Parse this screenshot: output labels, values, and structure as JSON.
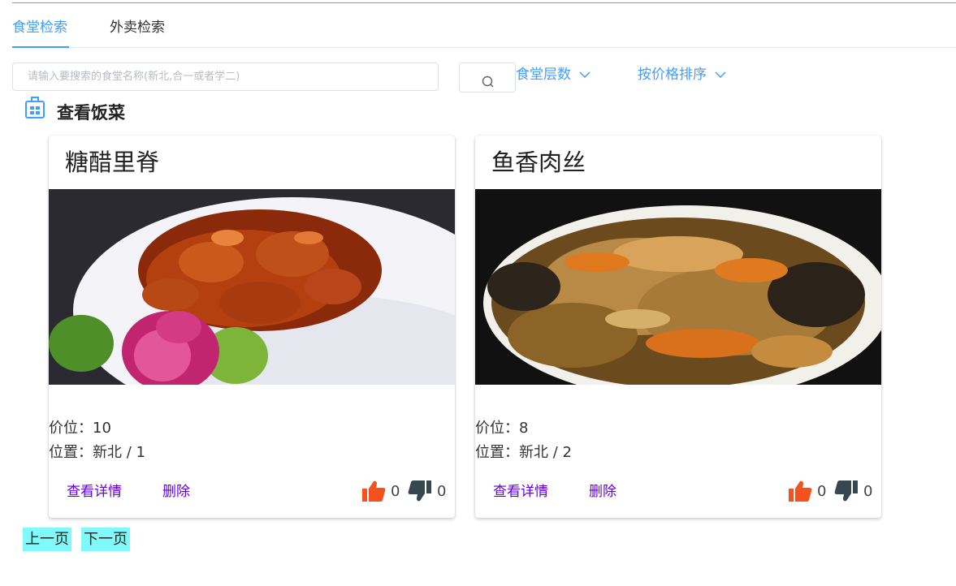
{
  "tabs": [
    {
      "label": "食堂检索",
      "active": true
    },
    {
      "label": "外卖检索",
      "active": false
    }
  ],
  "search": {
    "placeholder": "请输入要搜索的食堂名称(新北,合一或者学二)",
    "value": "",
    "button_icon": "search-icon"
  },
  "filters": {
    "floor_label": "食堂层数",
    "price_sort_label": "按价格排序"
  },
  "section": {
    "title": "查看饭菜",
    "icon": "building-icon"
  },
  "dishes": [
    {
      "name": "糖醋里脊",
      "price_label": "价位：",
      "price": "10",
      "location_label": "位置：",
      "location": "新北 / 1",
      "detail_label": "查看详情",
      "delete_label": "删除",
      "likes": "0",
      "dislikes": "0"
    },
    {
      "name": "鱼香肉丝",
      "price_label": "价位：",
      "price": "8",
      "location_label": "位置：",
      "location": "新北 / 2",
      "detail_label": "查看详情",
      "delete_label": "删除",
      "likes": "0",
      "dislikes": "0"
    }
  ],
  "pager": {
    "prev_label": "上一页",
    "next_label": "下一页"
  },
  "colors": {
    "accent": "#409eff",
    "action": "#6200ee",
    "like": "#f4511e",
    "dislike": "#37474f",
    "pager_bg": "#7ff9f9"
  }
}
